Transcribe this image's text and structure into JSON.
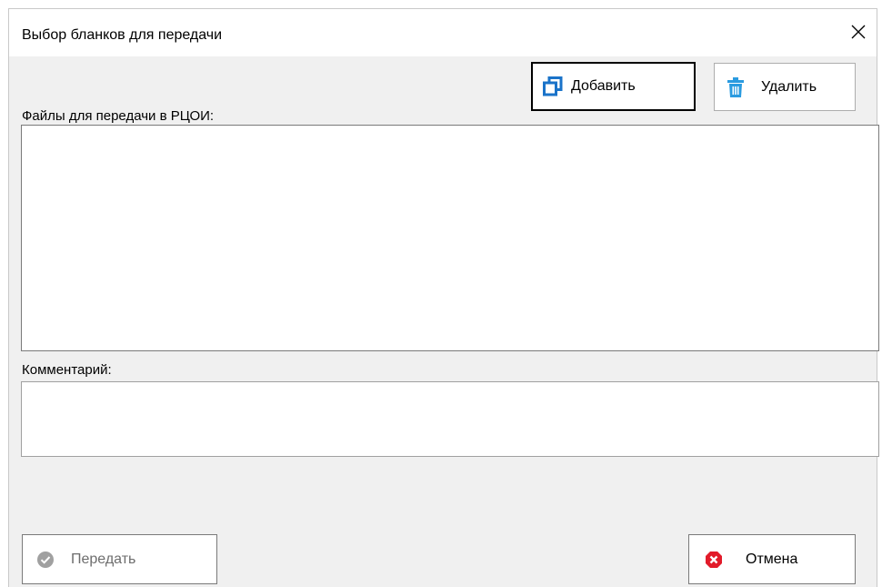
{
  "window": {
    "title": "Выбор бланков для передачи"
  },
  "toolbar": {
    "add_label": "Добавить",
    "delete_label": "Удалить"
  },
  "files": {
    "label": "Файлы для передачи в РЦОИ:"
  },
  "comment": {
    "label": "Комментарий:",
    "value": ""
  },
  "footer": {
    "send_label": "Передать",
    "cancel_label": "Отмена"
  },
  "colors": {
    "add_icon": "#1a73c9",
    "delete_icon": "#2a9be0",
    "cancel_icon": "#e21b2a",
    "send_icon_disabled": "#a0a0a0"
  }
}
